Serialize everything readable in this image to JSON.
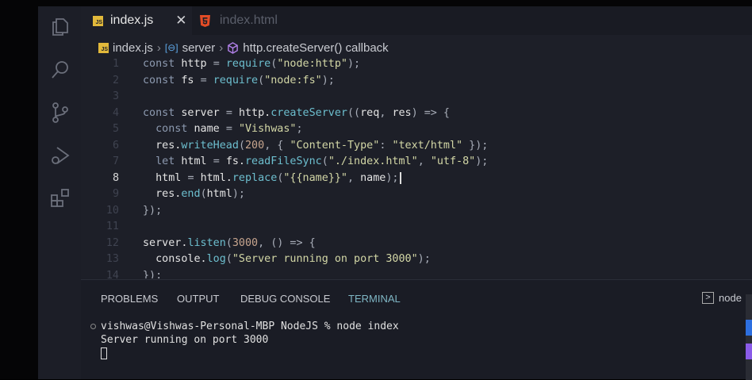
{
  "tabs": [
    {
      "label": "index.js",
      "active": true
    },
    {
      "label": "index.html",
      "active": false
    }
  ],
  "breadcrumb": [
    "index.js",
    "server",
    "http.createServer() callback"
  ],
  "code": [
    {
      "n": "1",
      "t": [
        [
          "kw",
          "const "
        ],
        [
          "",
          "http "
        ],
        [
          "pu",
          "= "
        ],
        [
          "fn",
          "require"
        ],
        [
          "pu",
          "("
        ],
        [
          "str",
          "\"node:http\""
        ],
        [
          "pu",
          ");"
        ]
      ]
    },
    {
      "n": "2",
      "t": [
        [
          "kw",
          "const "
        ],
        [
          "",
          "fs "
        ],
        [
          "pu",
          "= "
        ],
        [
          "fn",
          "require"
        ],
        [
          "pu",
          "("
        ],
        [
          "str",
          "\"node:fs\""
        ],
        [
          "pu",
          ");"
        ]
      ]
    },
    {
      "n": "3",
      "t": []
    },
    {
      "n": "4",
      "t": [
        [
          "kw",
          "const "
        ],
        [
          "",
          "server "
        ],
        [
          "pu",
          "= "
        ],
        [
          "",
          "http."
        ],
        [
          "fn",
          "createServer"
        ],
        [
          "pu",
          "(("
        ],
        [
          "",
          "req"
        ],
        [
          "pu",
          ", "
        ],
        [
          "",
          "res"
        ],
        [
          "pu",
          ") => {"
        ]
      ]
    },
    {
      "n": "5",
      "t": [
        [
          "",
          "  "
        ],
        [
          "kw",
          "const "
        ],
        [
          "",
          "name "
        ],
        [
          "pu",
          "= "
        ],
        [
          "str",
          "\"Vishwas\""
        ],
        [
          "pu",
          ";"
        ]
      ]
    },
    {
      "n": "6",
      "t": [
        [
          "",
          "  res."
        ],
        [
          "fn",
          "writeHead"
        ],
        [
          "pu",
          "("
        ],
        [
          "num",
          "200"
        ],
        [
          "pu",
          ", { "
        ],
        [
          "str",
          "\"Content-Type\""
        ],
        [
          "pu",
          ": "
        ],
        [
          "str",
          "\"text/html\""
        ],
        [
          "pu",
          " });"
        ]
      ]
    },
    {
      "n": "7",
      "t": [
        [
          "",
          "  "
        ],
        [
          "kw",
          "let "
        ],
        [
          "",
          "html "
        ],
        [
          "pu",
          "= "
        ],
        [
          "",
          "fs."
        ],
        [
          "fn",
          "readFileSync"
        ],
        [
          "pu",
          "("
        ],
        [
          "str",
          "\"./index.html\""
        ],
        [
          "pu",
          ", "
        ],
        [
          "str",
          "\"utf-8\""
        ],
        [
          "pu",
          ");"
        ]
      ]
    },
    {
      "n": "8",
      "cur": true,
      "t": [
        [
          "",
          "  html "
        ],
        [
          "pu",
          "= "
        ],
        [
          "",
          "html."
        ],
        [
          "fn",
          "replace"
        ],
        [
          "pu",
          "("
        ],
        [
          "str",
          "\"{{name}}\""
        ],
        [
          "pu",
          ", "
        ],
        [
          "",
          "name"
        ],
        [
          "pu",
          ");"
        ]
      ]
    },
    {
      "n": "9",
      "t": [
        [
          "",
          "  res."
        ],
        [
          "fn",
          "end"
        ],
        [
          "pu",
          "("
        ],
        [
          "",
          "html"
        ],
        [
          "pu",
          ");"
        ]
      ]
    },
    {
      "n": "10",
      "t": [
        [
          "pu",
          "});"
        ]
      ]
    },
    {
      "n": "11",
      "t": []
    },
    {
      "n": "12",
      "t": [
        [
          "",
          "server."
        ],
        [
          "fn",
          "listen"
        ],
        [
          "pu",
          "("
        ],
        [
          "num",
          "3000"
        ],
        [
          "pu",
          ", () => {"
        ]
      ]
    },
    {
      "n": "13",
      "t": [
        [
          "",
          "  console."
        ],
        [
          "fn",
          "log"
        ],
        [
          "pu",
          "("
        ],
        [
          "str",
          "\"Server running on port 3000\""
        ],
        [
          "pu",
          ");"
        ]
      ]
    },
    {
      "n": "14",
      "t": [
        [
          "pu",
          "});"
        ]
      ]
    }
  ],
  "panel": {
    "tabs": [
      "PROBLEMS",
      "OUTPUT",
      "DEBUG CONSOLE",
      "TERMINAL"
    ],
    "active": "TERMINAL",
    "terminal_name": "node"
  },
  "terminal": {
    "prompt": "vishwas@Vishwas-Personal-MBP NodeJS % node index",
    "output": "Server running on port 3000"
  },
  "colors": {
    "js_badge": "#e2b93b",
    "html_badge": "#e34c26",
    "terminal_active": "#7fb6c4"
  }
}
